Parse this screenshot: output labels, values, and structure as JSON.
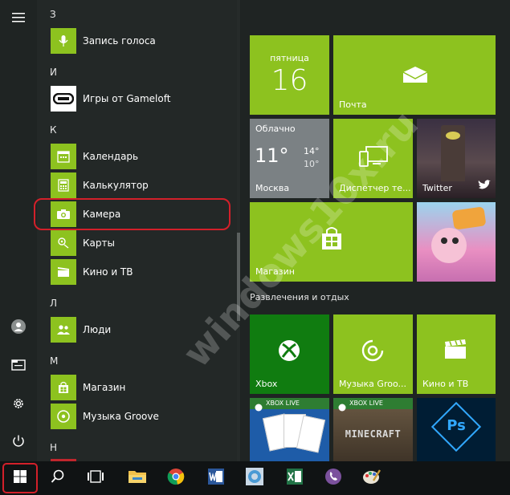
{
  "colors": {
    "tile_green": "#8dc21f",
    "highlight_red": "#d3202a",
    "weather_gray": "#7b8184"
  },
  "rail": {
    "icons": [
      "hamburger-icon",
      "user-icon",
      "explorer-icon",
      "gear-icon",
      "power-icon"
    ]
  },
  "app_list": {
    "groups": [
      {
        "letter": "З",
        "apps": [
          {
            "label": "Запись голоса",
            "icon": "mic-icon"
          }
        ]
      },
      {
        "letter": "И",
        "apps": [
          {
            "label": "Игры от Gameloft",
            "icon": "gameloft-icon"
          }
        ]
      },
      {
        "letter": "К",
        "apps": [
          {
            "label": "Календарь",
            "icon": "calendar-icon"
          },
          {
            "label": "Калькулятор",
            "icon": "calculator-icon"
          },
          {
            "label": "Камера",
            "icon": "camera-icon"
          },
          {
            "label": "Карты",
            "icon": "maps-icon"
          },
          {
            "label": "Кино и ТВ",
            "icon": "film-icon"
          }
        ]
      },
      {
        "letter": "Л",
        "apps": [
          {
            "label": "Люди",
            "icon": "people-icon"
          }
        ]
      },
      {
        "letter": "М",
        "apps": [
          {
            "label": "Магазин",
            "icon": "store-icon"
          },
          {
            "label": "Музыка Groove",
            "icon": "groove-icon"
          }
        ]
      },
      {
        "letter": "Н",
        "apps": []
      }
    ]
  },
  "tiles": {
    "calendar": {
      "day_name": "пятница",
      "day_number": "16"
    },
    "mail": {
      "label": "Почта"
    },
    "weather": {
      "condition": "Облачно",
      "temp": "11°",
      "high": "14°",
      "low": "10°",
      "city": "Москва"
    },
    "phone": {
      "label": "Диспетчер те..."
    },
    "twitter": {
      "label": "Twitter"
    },
    "store": {
      "label": "Магазин"
    },
    "candy": {
      "label": ""
    },
    "group_title": "Развлечения и отдых",
    "xbox": {
      "label": "Xbox"
    },
    "groove": {
      "label": "Музыка Groo..."
    },
    "movies": {
      "label": "Кино и ТВ"
    },
    "solitaire": {
      "badge": "XBOX LIVE"
    },
    "minecraft": {
      "badge": "XBOX LIVE",
      "title": "MINECRAFT"
    },
    "photoshop": {
      "label": "Ps"
    }
  },
  "watermark": "windows10x.ru",
  "taskbar": {
    "items": [
      "start-icon",
      "search-icon",
      "task-view-icon",
      "file-explorer-icon",
      "chrome-icon",
      "word-icon",
      "browser-icon",
      "excel-icon",
      "viber-icon",
      "paint-icon"
    ]
  }
}
